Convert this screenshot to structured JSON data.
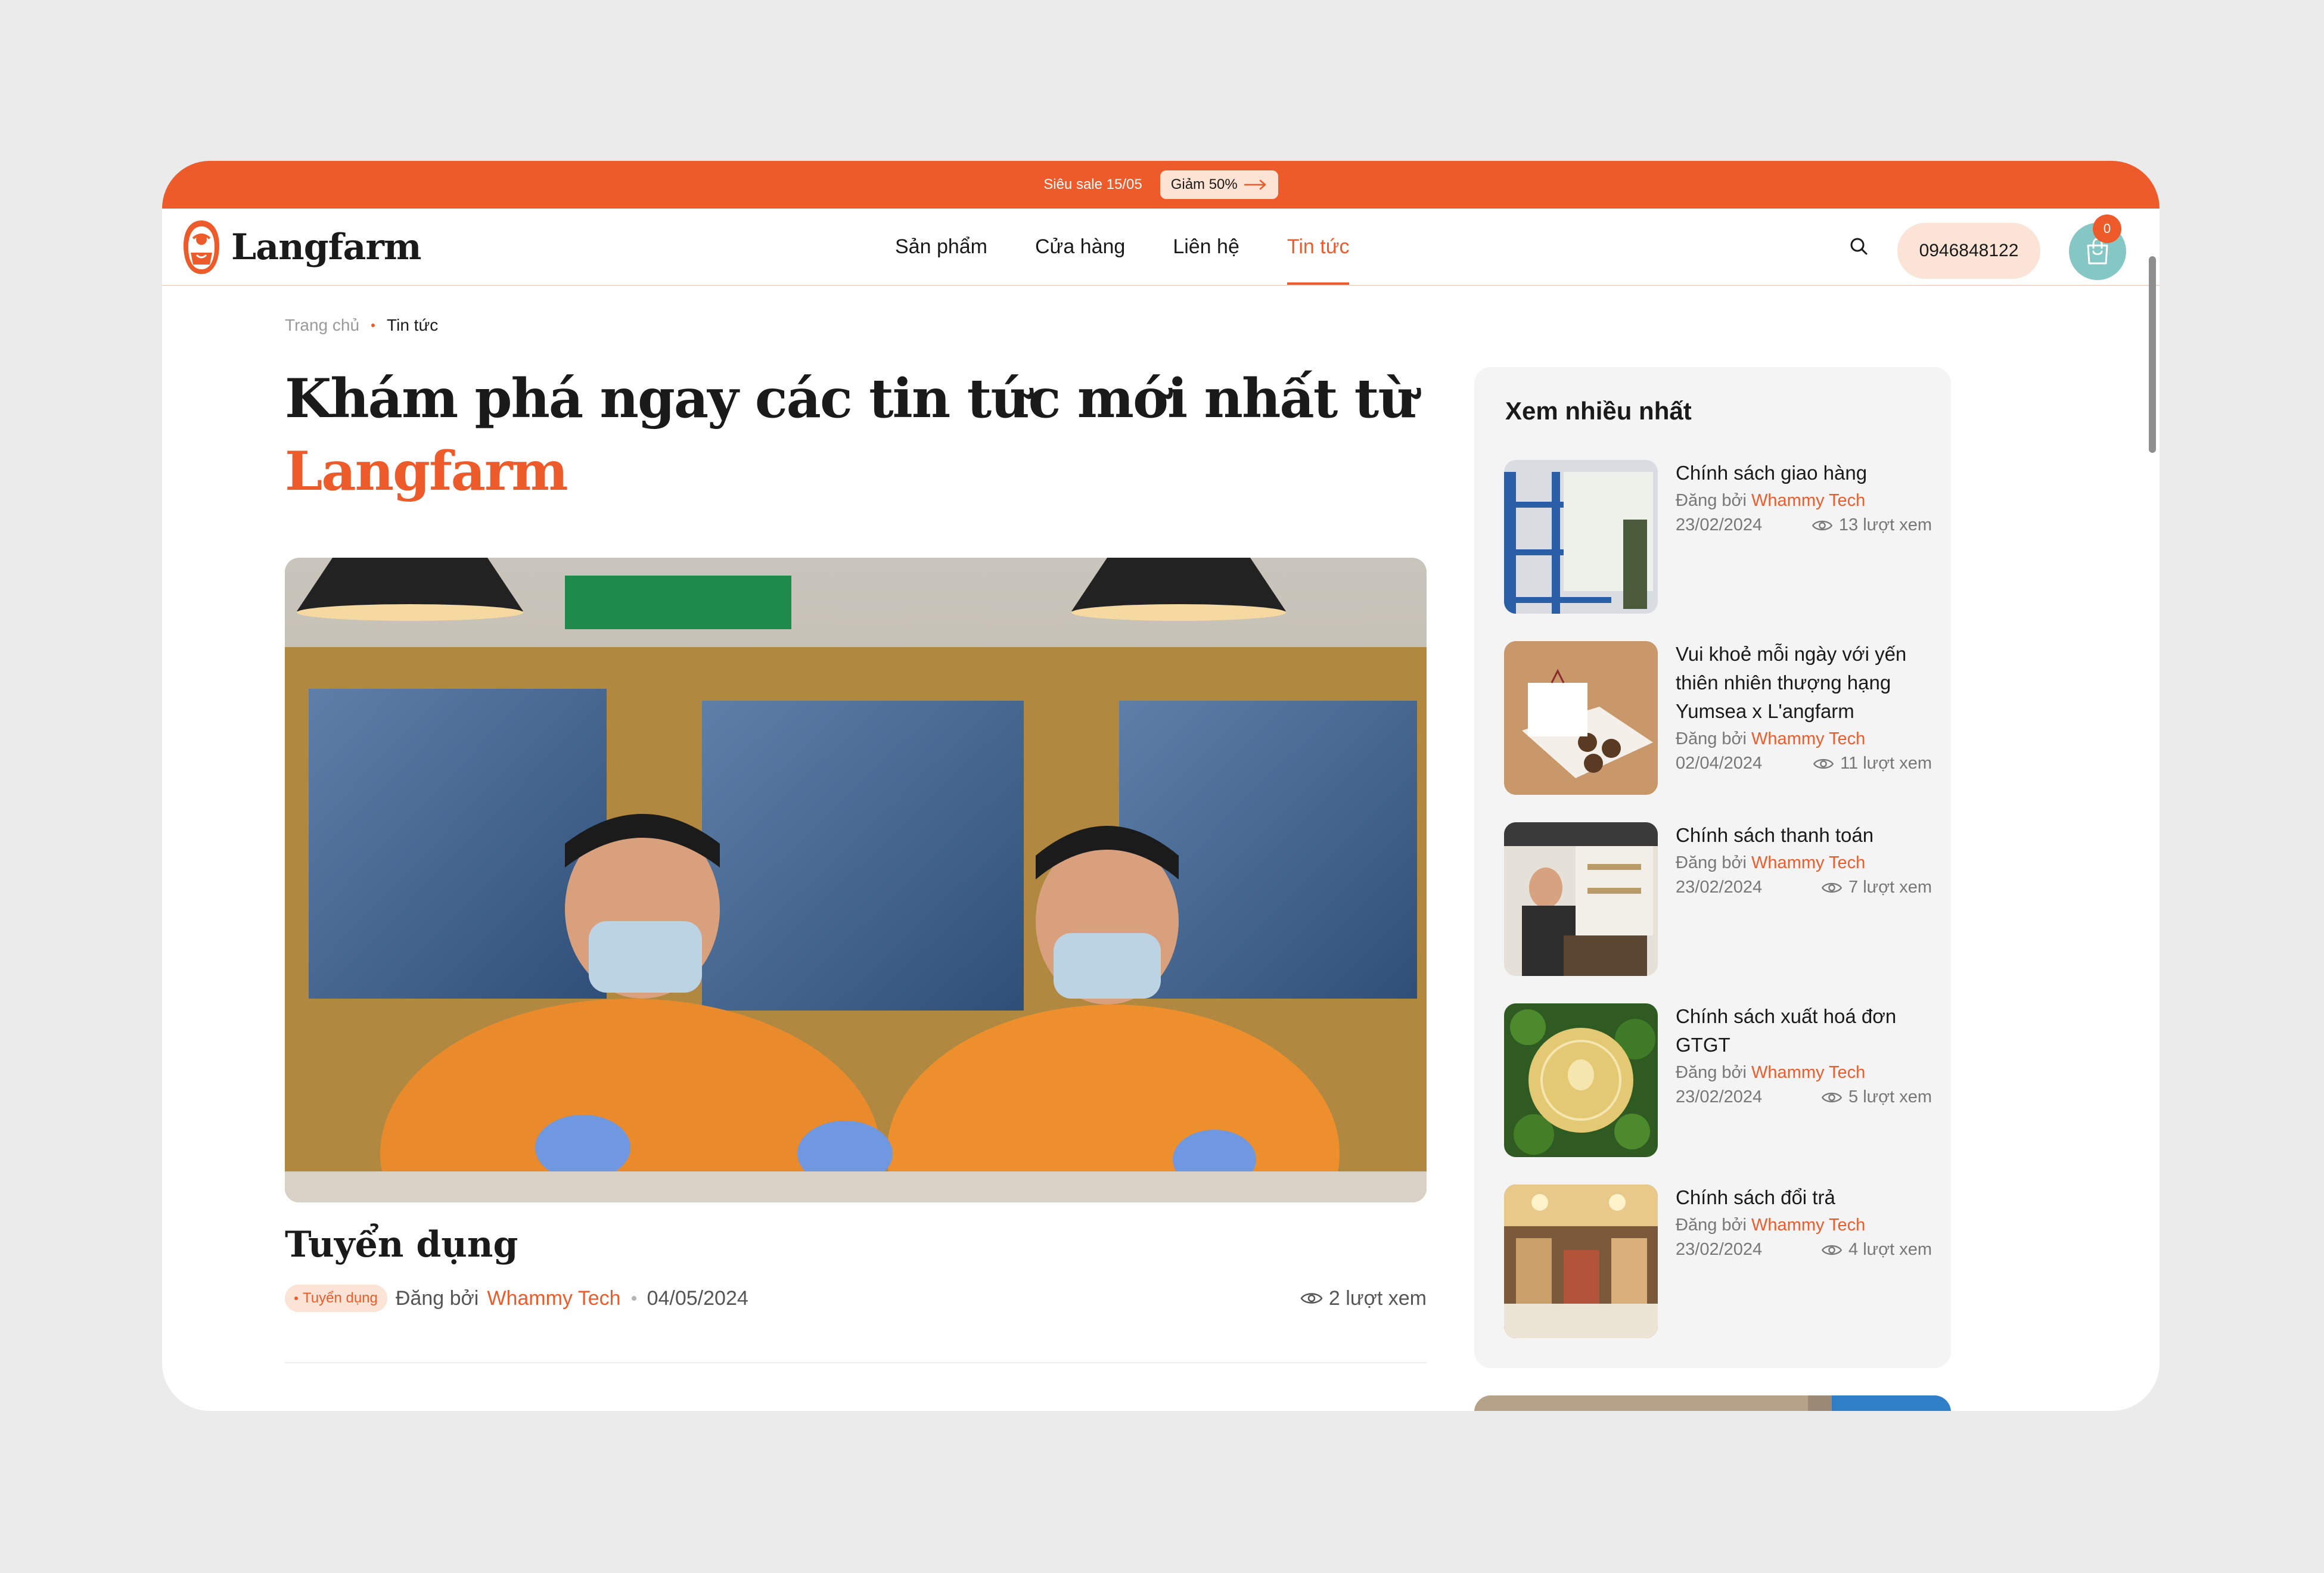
{
  "promo": {
    "text": "Siêu sale 15/05",
    "button_label": "Giảm 50%"
  },
  "header": {
    "brand": "Langfarm",
    "nav": [
      {
        "label": "Sản phẩm"
      },
      {
        "label": "Cửa hàng"
      },
      {
        "label": "Liên hệ"
      },
      {
        "label": "Tin tức",
        "active": true
      }
    ],
    "phone": "0946848122",
    "cart_count": "0"
  },
  "breadcrumb": {
    "home": "Trang chủ",
    "current": "Tin tức"
  },
  "page_title": {
    "line1": "Khám phá ngay các tin tức mới nhất từ",
    "accent": "Langfarm"
  },
  "featured": {
    "title": "Tuyển dụng",
    "tag": "Tuyển dụng",
    "posted_by": "Đăng bởi",
    "author": "Whammy Tech",
    "date": "04/05/2024",
    "views": "2 lượt xem"
  },
  "sidebar": {
    "title": "Xem nhiều nhất",
    "posted_by": "Đăng bởi",
    "posts": [
      {
        "title": "Chính sách giao hàng",
        "author": "Whammy Tech",
        "date": "23/02/2024",
        "views": "13 lượt xem"
      },
      {
        "title": "Vui khoẻ mỗi ngày với yến thiên nhiên thượng hạng Yumsea x L'angfarm",
        "author": "Whammy Tech",
        "date": "02/04/2024",
        "views": "11 lượt xem"
      },
      {
        "title": "Chính sách thanh toán",
        "author": "Whammy Tech",
        "date": "23/02/2024",
        "views": "7 lượt xem"
      },
      {
        "title": "Chính sách xuất hoá đơn GTGT",
        "author": "Whammy Tech",
        "date": "23/02/2024",
        "views": "5 lượt xem"
      },
      {
        "title": "Chính sách đổi trả",
        "author": "Whammy Tech",
        "date": "23/02/2024",
        "views": "4 lượt xem"
      }
    ]
  },
  "colors": {
    "accent": "#ec5b29",
    "accent_soft": "#fbe3d6",
    "cart": "#84c7c5",
    "sidebar_bg": "#f4f4f4",
    "page_bg": "#ebebeb"
  }
}
